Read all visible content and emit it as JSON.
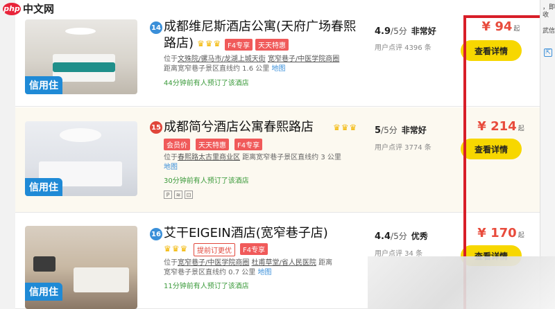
{
  "watermark": {
    "logo": "php",
    "site": "中文网"
  },
  "hotels": [
    {
      "rank": "14",
      "name_line1": "成都维尼斯酒店公寓(天府广场春熙",
      "name_line2": "路店)",
      "crowns": "♛♛♛",
      "tags": [
        "F4专享",
        "天天特惠"
      ],
      "loc_prefix": "位于",
      "loc_areas": "文殊院/骡马市/龙湖上城天街",
      "loc_areas2": "宽窄巷子/中医学院商圈",
      "loc_dist": "距离宽窄巷子景区直线约 1.6 公里",
      "map": "地图",
      "booked": "44分钟前有人预订了该酒店",
      "score": "4.9",
      "score_max": "/5分",
      "level": "非常好",
      "reviews": "用户点评 4396 条",
      "price_symbol": "¥",
      "price": "94",
      "price_unit": "起",
      "button": "查看详情",
      "credit": "信用住"
    },
    {
      "rank": "15",
      "name_line1": "成都简兮酒店公寓春熙路店",
      "name_line2": "",
      "crowns": "♛♛♛",
      "tags": [
        "会员价",
        "天天特惠",
        "F4专享"
      ],
      "loc_prefix": "位于",
      "loc_areas": "春熙路太古里商业区",
      "loc_areas2": "",
      "loc_dist": "距离宽窄巷子景区直线约 3 公里",
      "map": "地图",
      "booked": "30分钟前有人预订了该酒店",
      "facilities": [
        "P",
        "≋",
        "⊡"
      ],
      "score": "5",
      "score_max": "/5分",
      "level": "非常好",
      "reviews": "用户点评 3774 条",
      "price_symbol": "¥",
      "price": "214",
      "price_unit": "起",
      "button": "查看详情",
      "credit": "信用住"
    },
    {
      "rank": "16",
      "name_line1": "艾干EIGEIN酒店(宽窄巷子店)",
      "name_line2": "",
      "crowns": "♛♛♛",
      "tags": [
        "提前订更优",
        "F4专享"
      ],
      "loc_prefix": "位于",
      "loc_areas": "宽窄巷子/中医学院商圈",
      "loc_areas2": "杜甫草堂/省人民医院",
      "loc_dist": "宽窄巷子景区直线约 0.7 公里",
      "loc_dist_prefix": "距离",
      "map": "地图",
      "booked": "11分钟前有人预订了该酒店",
      "score": "4.4",
      "score_max": "/5分",
      "level": "优秀",
      "reviews": "用户点评 34 条",
      "price_symbol": "¥",
      "price": "170",
      "price_unit": "起",
      "button": "查看详情",
      "credit": "信用住"
    }
  ],
  "right_panel": {
    "text1": "，即收",
    "text2": "武信"
  },
  "colors": {
    "accent_red": "#d81e28",
    "button_yellow": "#f7d700",
    "price_red": "#e84b3c",
    "credit_blue": "#1f8ad6"
  }
}
